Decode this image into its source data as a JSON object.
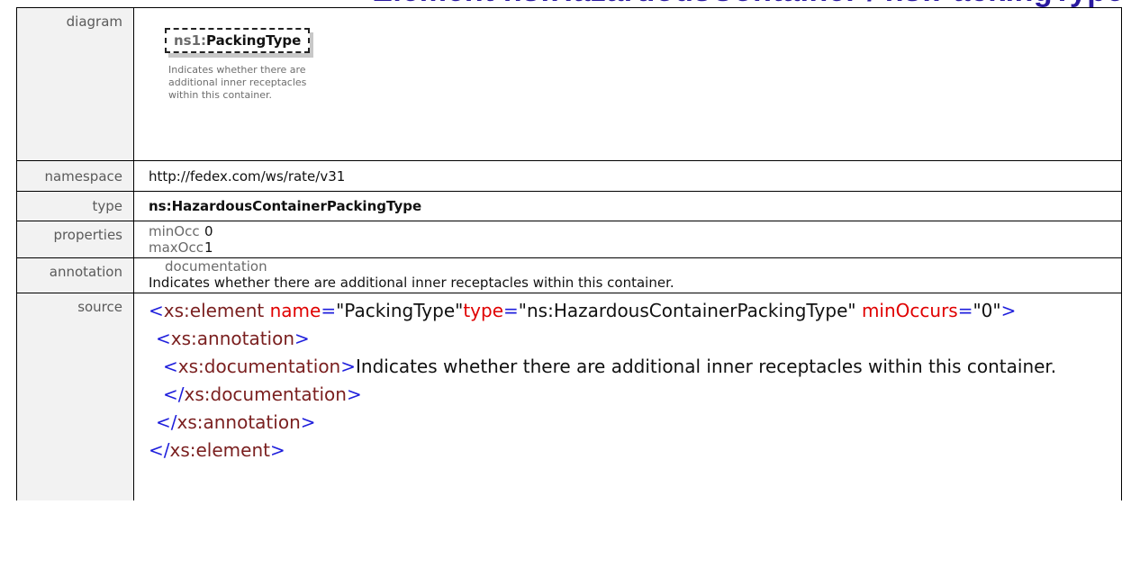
{
  "heading": {
    "title": "Element ns:HazardousContainer / ns:PackingType"
  },
  "diagram": {
    "label": "diagram",
    "node_prefix": "ns1:",
    "node_name": "PackingType",
    "doc_line1": "Indicates whether there are",
    "doc_line2": "additional inner receptacles",
    "doc_line3": "within this container."
  },
  "namespace": {
    "label": "namespace",
    "value": "http://fedex.com/ws/rate/v31"
  },
  "type": {
    "label": "type",
    "value": "ns:HazardousContainerPackingType"
  },
  "properties": {
    "label": "properties",
    "items": [
      {
        "name": "minOcc",
        "value": "0"
      },
      {
        "name": "maxOcc",
        "value": "1"
      }
    ]
  },
  "annotation": {
    "label": "annotation",
    "title": "documentation",
    "text": "Indicates whether there are additional inner receptacles within this container."
  },
  "source": {
    "label": "source",
    "lt": "<",
    "gt": ">",
    "end_open": "</",
    "eq": "=",
    "el_tag": "xs:element",
    "attr_name": "name",
    "name_val": "\"PackingType\"",
    "attr_type": "type",
    "type_val": "\"ns:HazardousContainerPackingType\"",
    "attr_min": "minOccurs",
    "min_val": "\"0\"",
    "anno_tag": "xs:annotation",
    "doc_tag": "xs:documentation",
    "doc_text": "Indicates whether there are additional inner receptacles within this container."
  },
  "colors": {
    "heading": "#2a1aa0",
    "tag_bracket": "#1e1edc",
    "tag_name": "#7a1f1f",
    "attribute": "#e00000",
    "label_bg": "#f2f2f2"
  }
}
